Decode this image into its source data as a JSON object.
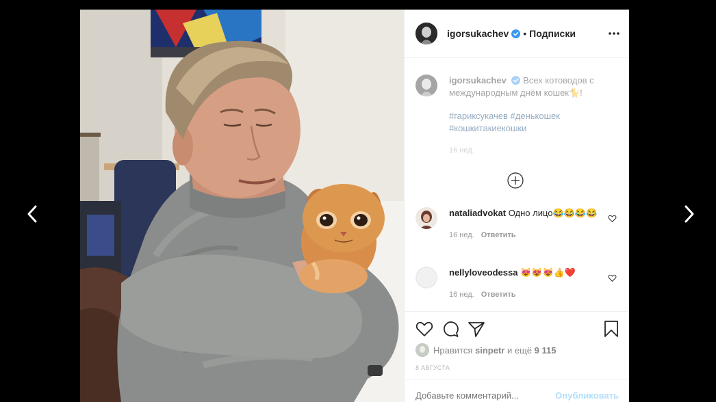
{
  "post": {
    "author": "igorsukachev",
    "separator": "•",
    "follow_label": "Подписки",
    "caption": {
      "text": "Всех котоводов с международным днём кошек🐈!",
      "hashtags": "#гарикcукачев #денькошек #кошкитакиекошки",
      "time": "16 нед."
    }
  },
  "comments": [
    {
      "user": "nataliadvokat",
      "text": "Одно лицо😂😂😂😂",
      "time": "16 нед.",
      "reply_label": "Ответить"
    },
    {
      "user": "nellyloveodessa",
      "text": "😻😻😻👍❤️",
      "time": "16 нед.",
      "reply_label": "Ответить"
    }
  ],
  "likes": {
    "prefix": "Нравится",
    "user": "sinpetr",
    "middle": "и ещё",
    "count": "9 115"
  },
  "date": "8 АВГУСТА",
  "comment_box": {
    "placeholder": "Добавьте комментарий...",
    "publish_label": "Опубликовать"
  },
  "icons": {
    "prev": "chevron-left-icon",
    "next": "chevron-right-icon",
    "more": "more-horizontal-icon",
    "verified": "verified-badge-icon",
    "load_more": "plus-circle-icon",
    "like": "heart-icon",
    "comment": "comment-icon",
    "share": "share-icon",
    "save": "bookmark-icon"
  },
  "colors": {
    "verified": "#3897f0",
    "link": "#00376b",
    "publish": "#b2dffc",
    "muted": "#999999"
  }
}
